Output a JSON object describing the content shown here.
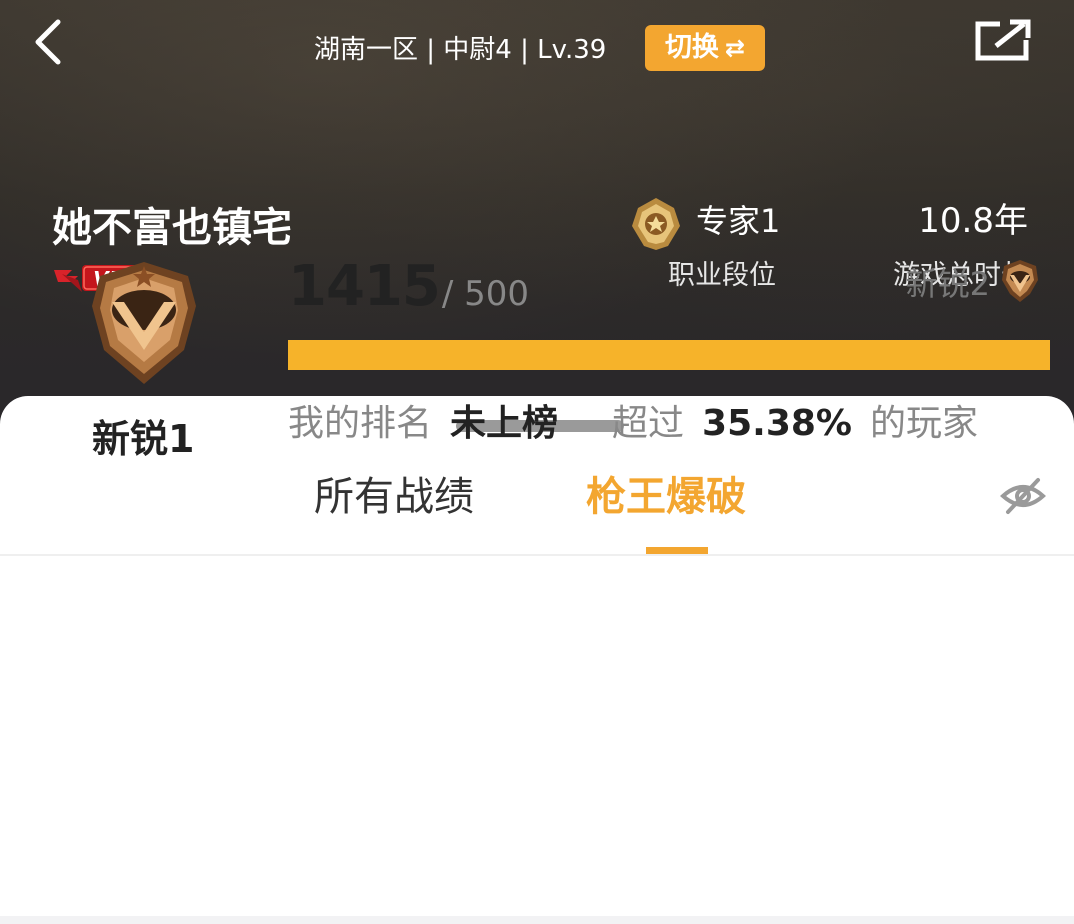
{
  "header": {
    "server_info": "湖南一区 | 中尉4 | Lv.39",
    "switch_label": "切换",
    "switch_arrows": "⇄",
    "back_icon": "chevron-left-icon",
    "share_icon": "share-icon"
  },
  "profile": {
    "nickname": "她不富也镇宅",
    "vip_badge": "VIP6",
    "career_rank": {
      "value": "专家1",
      "label": "职业段位"
    },
    "play_time": {
      "value": "10.8年",
      "label": "游戏总时长"
    }
  },
  "tabs": [
    {
      "label": "所有战绩",
      "active": false
    },
    {
      "label": "枪王爆破",
      "active": true
    }
  ],
  "visibility_icon": "eye-off-icon",
  "mode_stats": {
    "tier_name": "新锐1",
    "score_current": "1415",
    "score_total": "/ 500",
    "next_tier": "新锐2",
    "progress_fraction": 1.0,
    "ranking_label": "我的排名",
    "ranking_value": "未上榜",
    "exceed_label": "超过",
    "exceed_value": "35.38%",
    "exceed_suffix": "的玩家"
  },
  "colors": {
    "accent": "#f3a630",
    "progress": "#f6b32a",
    "header_bg": "#2e2b27"
  }
}
